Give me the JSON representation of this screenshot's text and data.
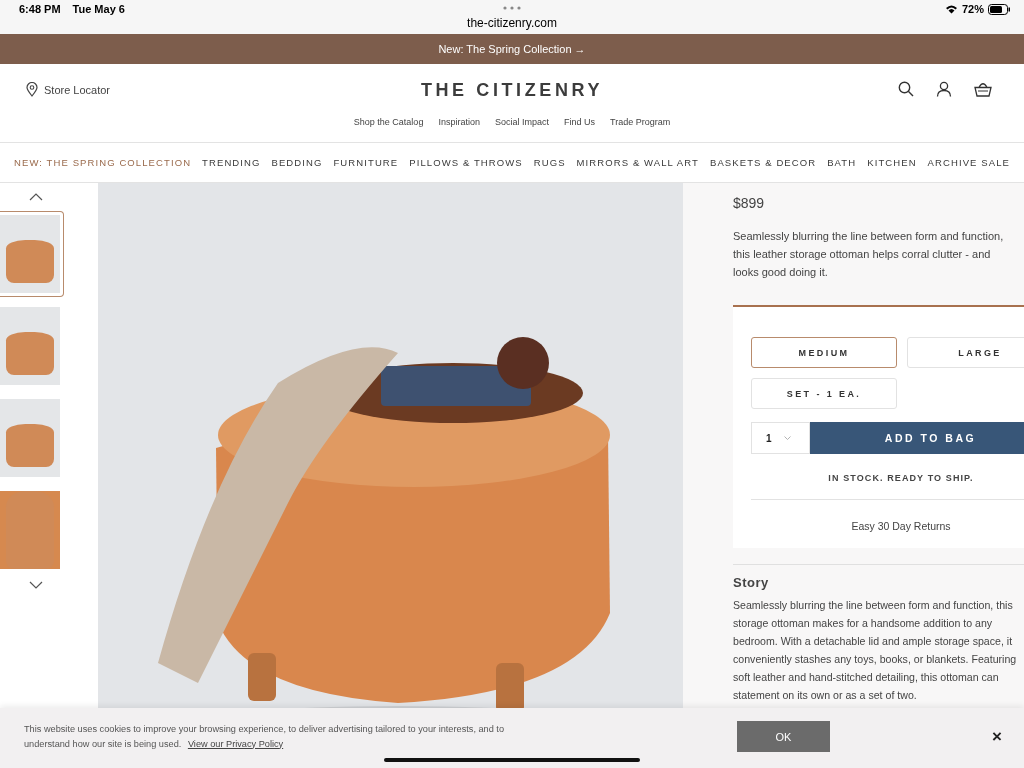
{
  "status_bar": {
    "time": "6:48 PM",
    "date": "Tue May 6",
    "url": "the-citizenry.com",
    "battery": "72%"
  },
  "promo_banner": {
    "text": "New: The Spring Collection",
    "arrow": "→"
  },
  "header": {
    "store_locator": "Store Locator",
    "logo": "THE CITIZENRY",
    "links": [
      "Shop the Catalog",
      "Inspiration",
      "Social Impact",
      "Find Us",
      "Trade Program"
    ]
  },
  "categories": [
    {
      "label": "NEW: THE SPRING COLLECTION",
      "selected": true
    },
    {
      "label": "TRENDING",
      "selected": false
    },
    {
      "label": "BEDDING",
      "selected": false
    },
    {
      "label": "FURNITURE",
      "selected": false
    },
    {
      "label": "PILLOWS & THROWS",
      "selected": false
    },
    {
      "label": "RUGS",
      "selected": false
    },
    {
      "label": "MIRRORS & WALL ART",
      "selected": false
    },
    {
      "label": "BASKETS & DECOR",
      "selected": false
    },
    {
      "label": "BATH",
      "selected": false
    },
    {
      "label": "KITCHEN",
      "selected": false
    },
    {
      "label": "ARCHIVE SALE",
      "selected": false
    }
  ],
  "gallery": {
    "thumbnails": [
      {
        "selected": true
      },
      {
        "selected": false
      },
      {
        "selected": false
      },
      {
        "selected": false
      }
    ]
  },
  "product": {
    "price": "$899",
    "description": "Seamlessly blurring the line between form and function, this leather storage ottoman helps corral clutter - and looks good doing it.",
    "sizes": [
      {
        "label": "MEDIUM",
        "selected": true
      },
      {
        "label": "LARGE",
        "selected": false
      },
      {
        "label": "SET - 1 EA.",
        "selected": false
      }
    ],
    "quantity": "1",
    "add_button": "ADD TO BAG",
    "stock": "IN STOCK. READY TO SHIP.",
    "returns": "Easy 30 Day Returns",
    "story_title": "Story",
    "story_lines": [
      "Seamlessly blurring the line between form and function, this",
      "storage ottoman makes for a handsome addition to any",
      "bedroom. With a detachable lid and ample storage space, it",
      "conveniently stashes any toys, books, or blankets. Featuring",
      "soft leather and hand-stitched detailing, this ottoman can",
      "statement on its own or as a set of two."
    ]
  },
  "cookie_banner": {
    "text": "This website uses cookies to improve your browsing experience, to deliver advertising tailored to your interests, and to understand how our site is being used.",
    "link": "View our Privacy Policy",
    "ok_button": "OK",
    "close": "×"
  }
}
